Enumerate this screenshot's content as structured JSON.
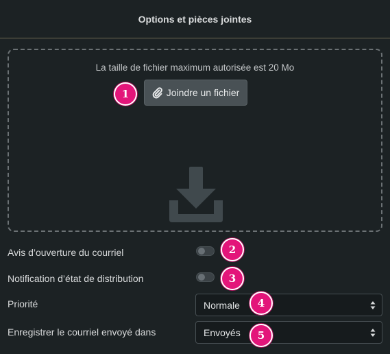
{
  "header": {
    "title": "Options et pièces jointes"
  },
  "dropzone": {
    "max_size_text": "La taille de fichier maximum autorisée est 20 Mo",
    "attach_button_label": "Joindre un fichier",
    "attach_icon": "paperclip-icon",
    "drop_icon": "download-icon"
  },
  "options": {
    "read_receipt_label": "Avis d’ouverture du courriel",
    "delivery_status_label": "Notification d’état de distribution",
    "priority_label": "Priorité",
    "priority_value": "Normale",
    "save_sent_label": "Enregistrer le courriel envoyé dans",
    "save_sent_value": "Envoyés"
  },
  "badges": [
    "1",
    "2",
    "3",
    "4",
    "5"
  ],
  "colors": {
    "background": "#1c2224",
    "badge": "#e3157a",
    "button": "#495155",
    "select_background": "#161b1d"
  }
}
